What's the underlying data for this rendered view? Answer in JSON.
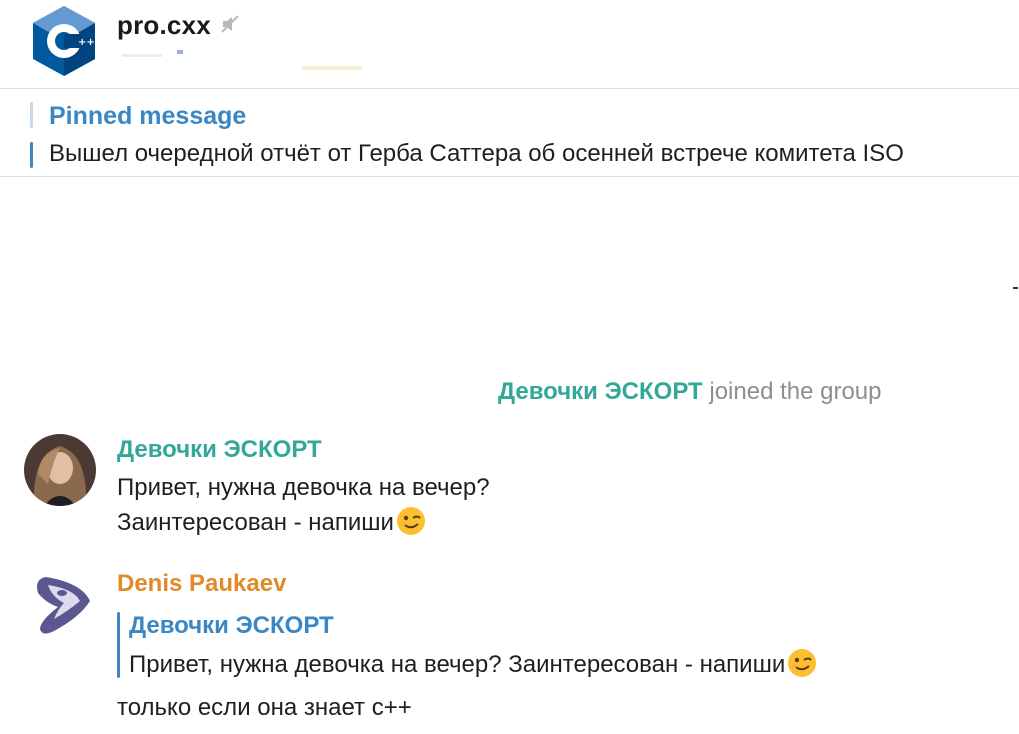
{
  "chat": {
    "title": "pro.cxx",
    "avatar_icon": "cpp-logo-icon",
    "muted_icon": "muted-speaker-icon"
  },
  "pinned": {
    "title": "Pinned message",
    "text": "Вышел очередной отчёт от Герба Саттера об осенней встрече комитета ISO"
  },
  "system_message": {
    "name": "Девочки ЭСКОРТ",
    "text": "joined the group"
  },
  "messages": [
    {
      "sender": "Девочки ЭСКОРТ",
      "sender_color": "#33a89a",
      "lines": [
        "Привет, нужна девочка на вечер?",
        "Заинтересован - напиши"
      ],
      "emoji": "winking-face-icon"
    },
    {
      "sender": "Denis Paukaev",
      "sender_color": "#e08a2a",
      "reply": {
        "name": "Девочки ЭСКОРТ",
        "text": "Привет, нужна девочка на вечер? Заинтересован - напиши"
      },
      "text": "только если она знает с++"
    }
  ],
  "colors": {
    "accent_blue": "#3a87c5",
    "escort_green": "#33a89a",
    "denis_orange": "#e08a2a"
  }
}
